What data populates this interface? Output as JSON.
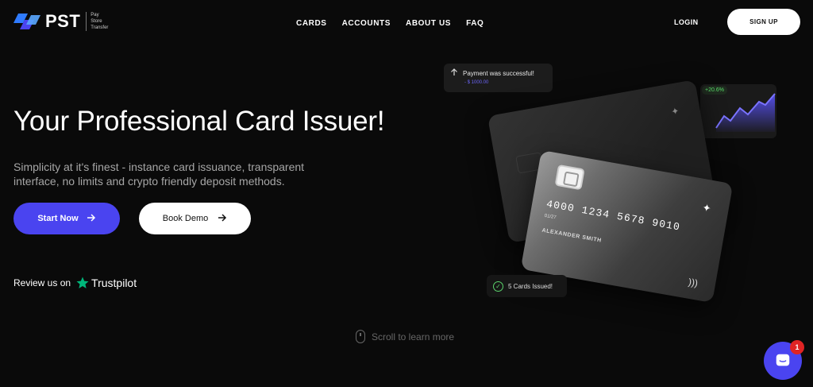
{
  "header": {
    "logo_text": "PST",
    "logo_sub": [
      "Pay",
      "Store",
      "Transfer"
    ],
    "nav": [
      "CARDS",
      "ACCOUNTS",
      "ABOUT US",
      "FAQ"
    ],
    "login": "LOGIN",
    "signup": "SIGN UP"
  },
  "hero": {
    "title": "Your Professional Card Issuer!",
    "subtitle": "Simplicity at it's finest - instance card issuance, transparent interface, no limits and crypto friendly deposit methods.",
    "primary_button": "Start Now",
    "secondary_button": "Book Demo",
    "review_prefix": "Review us on",
    "review_brand": "Trustpilot"
  },
  "visual": {
    "payment_text": "Payment was successful!",
    "payment_amount": "- $ 1000.00",
    "growth": "+20.6%",
    "card_number": "4000 1234 5678 9010",
    "card_expiry": "01/27",
    "card_holder": "ALEXANDER SMITH",
    "issued": "5 Cards Issued!"
  },
  "footer": {
    "scroll_text": "Scroll to learn more",
    "chat_badge": "1"
  },
  "colors": {
    "accent": "#4a44f0",
    "background": "#0a0a0a",
    "success": "#5ad36b"
  },
  "icons": [
    "arrow-right-icon",
    "trustpilot-star-icon",
    "chat-icon",
    "mouse-icon",
    "check-icon",
    "arrow-up-icon",
    "sparkle-icon",
    "nfc-icon"
  ]
}
